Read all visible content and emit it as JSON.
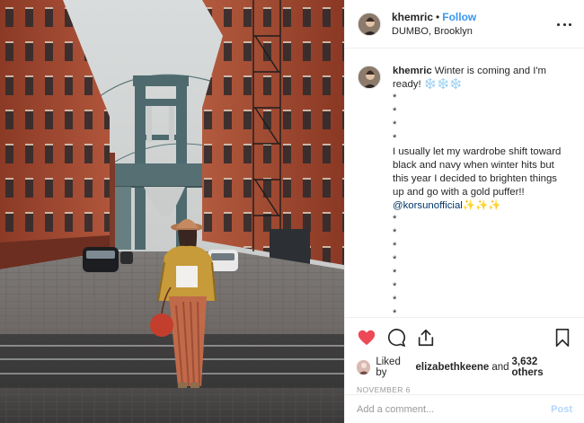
{
  "post": {
    "username": "khemric",
    "separator": "•",
    "follow_label": "Follow",
    "location": "DUMBO, Brooklyn",
    "photo_icon": "street-photo"
  },
  "caption": {
    "username": "khemric",
    "first_line": "Winter is coming and I'm ready!",
    "snow_emoji": "❄️❄️❄️",
    "star_lines_top": [
      "*",
      "*",
      "*",
      "*"
    ],
    "body_text": "I usually let my wardrobe shift toward black and navy when winter hits but this year I decided to brighten things up and go with a gold puffer!!",
    "mention": "@korsunofficial",
    "sparkle_emoji": "✨✨✨",
    "star_lines_bottom": [
      "*",
      "*",
      "*",
      "*",
      "*",
      "*",
      "*",
      "*"
    ]
  },
  "actions": {
    "like_icon": "heart-icon",
    "comment_icon": "comment-icon",
    "share_icon": "share-icon",
    "save_icon": "bookmark-icon"
  },
  "likes": {
    "prefix": "Liked by",
    "user": "elizabethkeene",
    "joiner": "and",
    "count": "3,632 others"
  },
  "date": "NOVEMBER 6",
  "comment_box": {
    "placeholder": "Add a comment...",
    "post_label": "Post"
  },
  "colors": {
    "link": "#3897f0",
    "like_red": "#ed4956",
    "post_disabled": "#b3d7fb"
  }
}
